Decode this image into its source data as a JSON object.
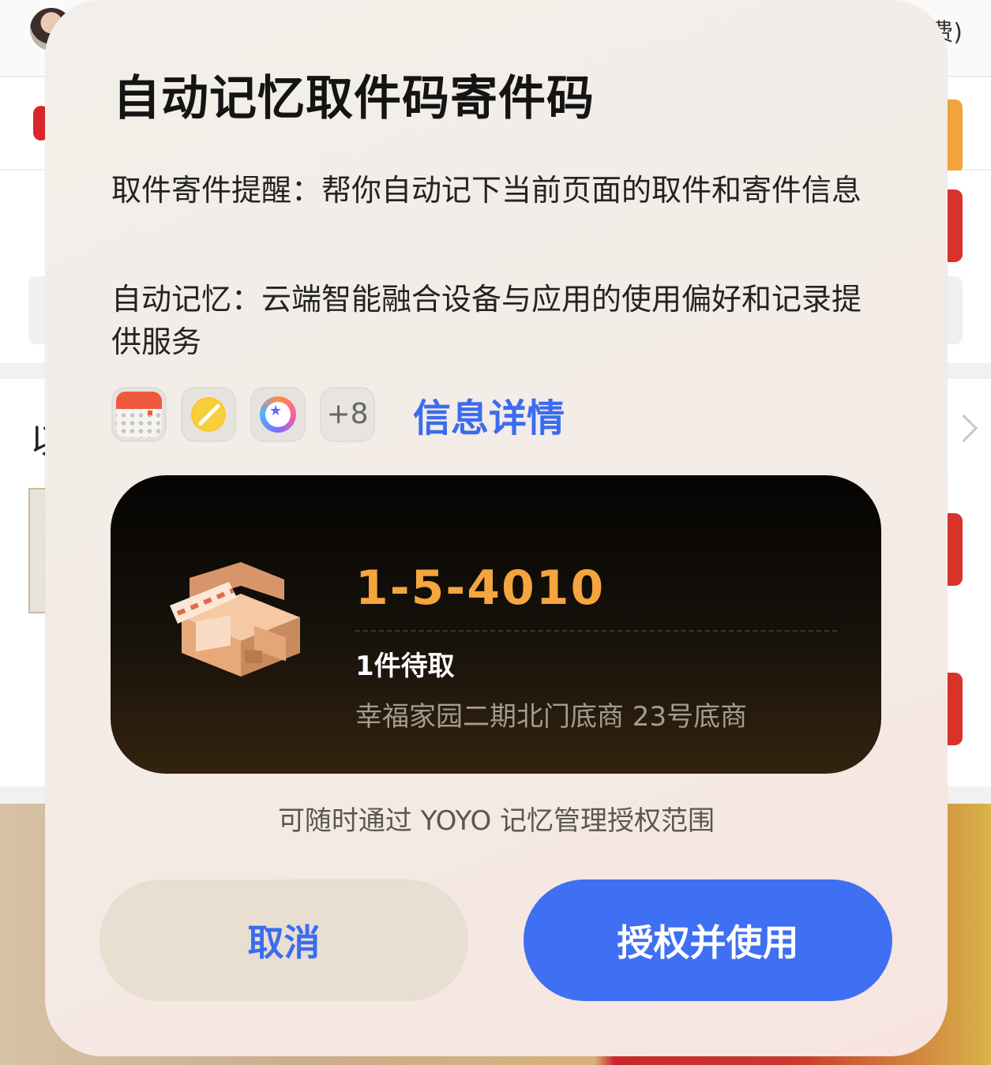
{
  "background": {
    "top_right_text": "费)",
    "side_char": "以"
  },
  "dialog": {
    "title": "自动记忆取件码寄件码",
    "desc_pickup": "取件寄件提醒：帮你自动记下当前页面的取件和寄件信息",
    "desc_memory": "自动记忆：云端智能融合设备与应用的使用偏好和记录提供服务",
    "apps": {
      "icons": [
        "calendar-icon",
        "notes-icon",
        "yoyo-assistant-icon"
      ],
      "more_count": "+8",
      "details_link": "信息详情"
    },
    "card": {
      "icon": "express-station-icon",
      "code": "1-5-4010",
      "pending": "1件待取",
      "address": "幸福家园二期北门底商 23号底商"
    },
    "hint": "可随时通过 YOYO 记忆管理授权范围",
    "buttons": {
      "cancel": "取消",
      "confirm": "授权并使用"
    }
  },
  "colors": {
    "accent_blue": "#3F6FF2",
    "code_orange": "#F4A53E",
    "card_dark": "#050403"
  }
}
